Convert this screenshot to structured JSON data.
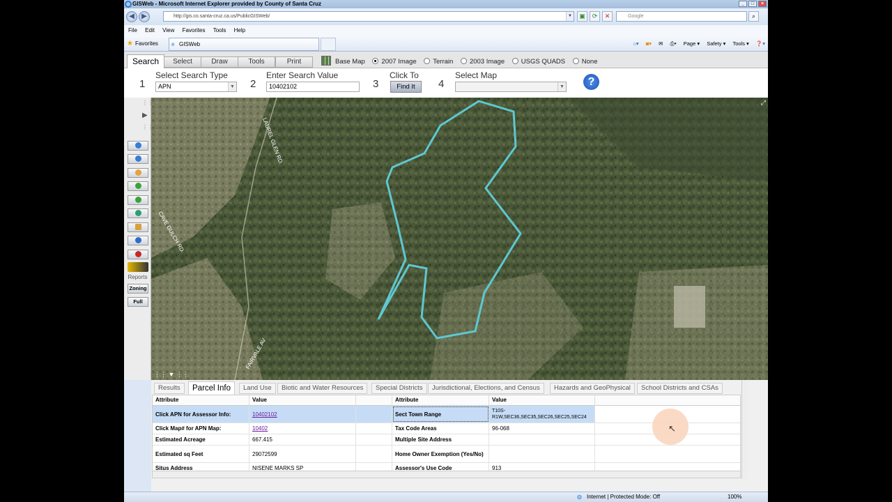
{
  "window": {
    "title": "GISWeb - Microsoft Internet Explorer provided by County of Santa Cruz"
  },
  "address": {
    "url": "http://gis.co.santa-cruz.ca.us/PublicGISWeb/",
    "search_placeholder": "Google"
  },
  "menu": [
    "File",
    "Edit",
    "View",
    "Favorites",
    "Tools",
    "Help"
  ],
  "favbar": {
    "favorites": "Favorites",
    "tab": "GISWeb"
  },
  "commandbar": {
    "page": "Page ▾",
    "safety": "Safety ▾",
    "tools": "Tools ▾"
  },
  "app_tabs": [
    "Search",
    "Select",
    "Draw",
    "Tools",
    "Print"
  ],
  "basemap": {
    "label": "Base Map",
    "options": [
      "2007 Image",
      "Terrain",
      "2003 Image",
      "USGS QUADS",
      "None"
    ],
    "selected": "2007 Image"
  },
  "search": {
    "steps": [
      {
        "num": "1",
        "label": "Select Search Type"
      },
      {
        "num": "2",
        "label": "Enter Search Value"
      },
      {
        "num": "3",
        "label": "Click To"
      },
      {
        "num": "4",
        "label": "Select Map"
      }
    ],
    "type_value": "APN",
    "search_value": "10402102",
    "find_label": "Find It",
    "map_value": "",
    "help": "?"
  },
  "left_tools": {
    "reports": "Reports",
    "zoning": "Zoning",
    "full": "Full"
  },
  "map": {
    "roads": [
      "LAUREL GLEN RD",
      "CAVE GULCH RD",
      "FAIRVALE AV"
    ]
  },
  "bottom_tabs": [
    "Results",
    "Parcel Info",
    "Land Use",
    "Biotic and Water Resources",
    "Special Districts",
    "Jurisdictional, Elections, and Census",
    "Hazards and GeoPhysical",
    "School Districts and CSAs"
  ],
  "grid": {
    "headers": [
      "Attribute",
      "Value",
      "Attribute",
      "Value"
    ],
    "rows": [
      [
        "Click APN for Assessor Info:",
        "10402102",
        "Sect Town Range",
        "T10S-R1W,SEC36,SEC35,SEC26,SEC25,SEC24"
      ],
      [
        "Click Map# for APN Map:",
        "10402",
        "Tax Code Areas",
        "96-068"
      ],
      [
        "Estimated Acreage",
        "667.415",
        "Multiple Site Address",
        ""
      ],
      [
        "Estimated sq Feet",
        "29072599",
        "Home Owner Exemption (Yes/No)",
        ""
      ],
      [
        "Situs Address",
        "NISENE MARKS SP",
        "Assessor's Use Code",
        "913"
      ]
    ]
  },
  "status": {
    "zone": "Internet | Protected Mode: Off",
    "zoom": "100%"
  },
  "colors": {
    "parcel_outline": "#5ec8d2",
    "highlight_row": "#c6dcf6"
  }
}
